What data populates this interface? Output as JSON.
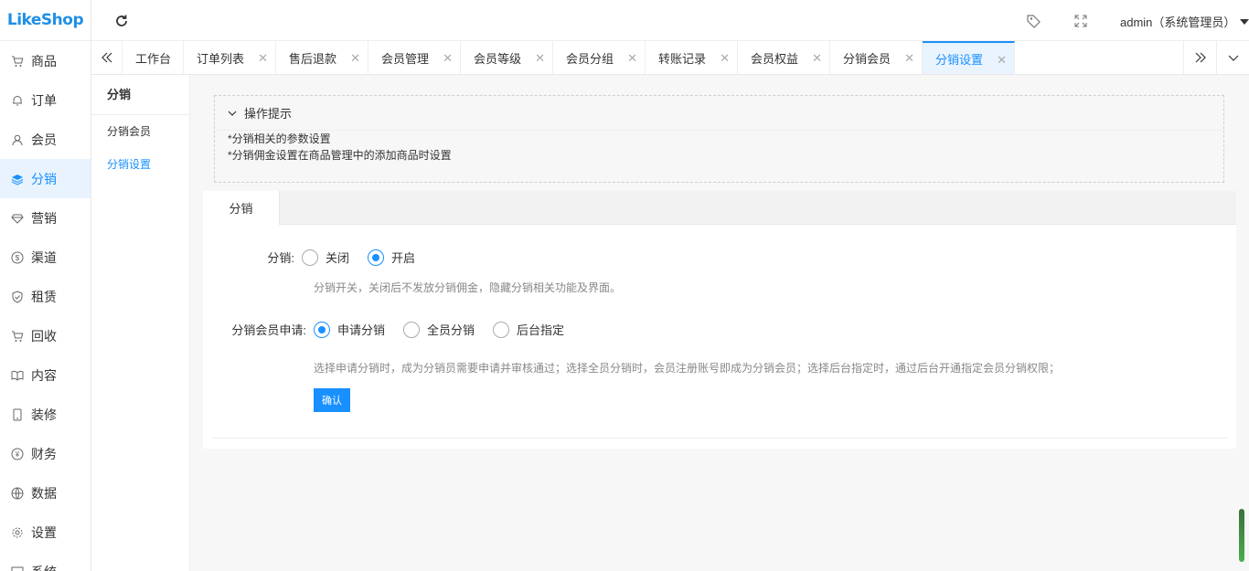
{
  "app": {
    "logo": "LikeShop"
  },
  "header": {
    "user": "admin（系统管理员）"
  },
  "sidebar": {
    "items": [
      {
        "label": "商品",
        "icon": "cart-icon"
      },
      {
        "label": "订单",
        "icon": "bell-icon"
      },
      {
        "label": "会员",
        "icon": "user-icon"
      },
      {
        "label": "分销",
        "icon": "layers-icon",
        "active": true
      },
      {
        "label": "营销",
        "icon": "diamond-icon"
      },
      {
        "label": "渠道",
        "icon": "dollar-icon"
      },
      {
        "label": "租赁",
        "icon": "shield-icon"
      },
      {
        "label": "回收",
        "icon": "cart-icon"
      },
      {
        "label": "内容",
        "icon": "book-icon"
      },
      {
        "label": "装修",
        "icon": "phone-icon"
      },
      {
        "label": "财务",
        "icon": "yen-icon"
      },
      {
        "label": "数据",
        "icon": "globe-icon"
      },
      {
        "label": "设置",
        "icon": "gear-icon"
      },
      {
        "label": "系统",
        "icon": "system-icon"
      }
    ]
  },
  "tabs": [
    {
      "label": "工作台",
      "closable": false
    },
    {
      "label": "订单列表",
      "closable": true
    },
    {
      "label": "售后退款",
      "closable": true
    },
    {
      "label": "会员管理",
      "closable": true
    },
    {
      "label": "会员等级",
      "closable": true
    },
    {
      "label": "会员分组",
      "closable": true
    },
    {
      "label": "转账记录",
      "closable": true
    },
    {
      "label": "会员权益",
      "closable": true
    },
    {
      "label": "分销会员",
      "closable": true
    },
    {
      "label": "分销设置",
      "closable": true,
      "active": true
    }
  ],
  "submenu": {
    "title": "分销",
    "items": [
      {
        "label": "分销会员"
      },
      {
        "label": "分销设置",
        "active": true
      }
    ]
  },
  "tips": {
    "title": "操作提示",
    "lines": [
      "*分销相关的参数设置",
      "*分销佣金设置在商品管理中的添加商品时设置"
    ]
  },
  "form": {
    "tab": "分销",
    "distribution": {
      "label": "分销:",
      "options": [
        "关闭",
        "开启"
      ],
      "selected": "开启",
      "help": "分销开关，关闭后不发放分销佣金，隐藏分销相关功能及界面。"
    },
    "apply": {
      "label": "分销会员申请:",
      "options": [
        "申请分销",
        "全员分销",
        "后台指定"
      ],
      "selected": "申请分销",
      "help": "选择申请分销时，成为分销员需要申请并审核通过；选择全员分销时，会员注册账号即成为分销会员；选择后台指定时，通过后台开通指定会员分销权限；"
    },
    "confirm_label": "确认"
  },
  "colors": {
    "accent": "#1890ff",
    "logo": "#1f8fe5",
    "active_bg": "#e8f3fe"
  }
}
